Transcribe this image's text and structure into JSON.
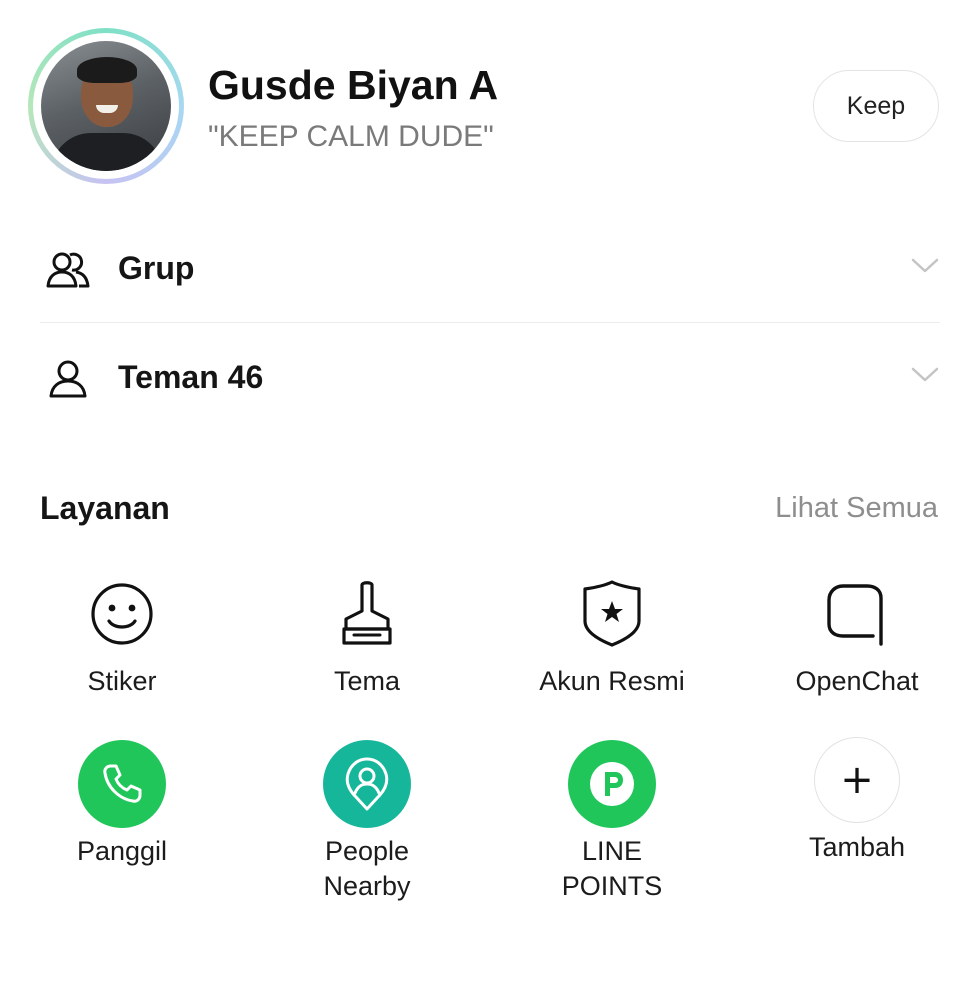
{
  "profile": {
    "name": "Gusde Biyan A",
    "status": "\"KEEP CALM DUDE\"",
    "keep_label": "Keep"
  },
  "rows": {
    "group_label": "Grup",
    "friends_label": "Teman 46"
  },
  "services": {
    "title": "Layanan",
    "see_all": "Lihat Semua",
    "items": [
      {
        "label": "Stiker",
        "icon": "smiley-icon"
      },
      {
        "label": "Tema",
        "icon": "brush-icon"
      },
      {
        "label": "Akun Resmi",
        "icon": "shield-star-icon"
      },
      {
        "label": "OpenChat",
        "icon": "open-chat-icon"
      },
      {
        "label": "Panggil",
        "icon": "phone-icon"
      },
      {
        "label": "People\nNearby",
        "icon": "location-pin-person-icon"
      },
      {
        "label": "LINE\nPOINTS",
        "icon": "points-p-icon"
      },
      {
        "label": "Tambah",
        "icon": "plus-icon"
      }
    ]
  },
  "colors": {
    "green": "#21c65a",
    "teal": "#16b69b",
    "muted_text": "#8e8e8e"
  }
}
